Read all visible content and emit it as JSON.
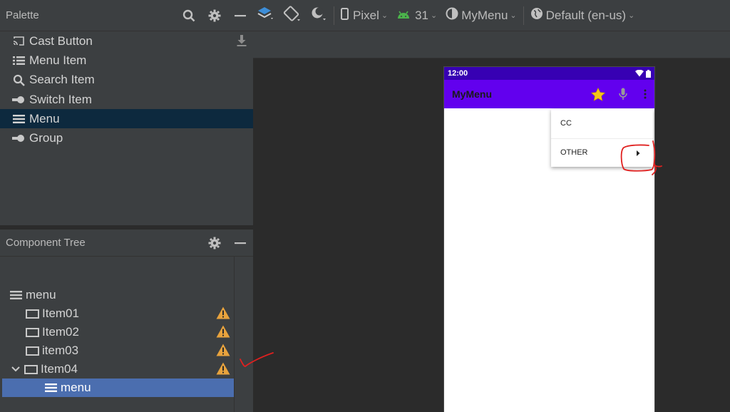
{
  "palette": {
    "title": "Palette",
    "items": [
      {
        "label": "Cast Button",
        "icon": "cast-icon"
      },
      {
        "label": "Menu Item",
        "icon": "list-icon"
      },
      {
        "label": "Search Item",
        "icon": "search-icon"
      },
      {
        "label": "Switch Item",
        "icon": "switch-icon"
      },
      {
        "label": "Menu",
        "icon": "menu-icon"
      },
      {
        "label": "Group",
        "icon": "switch-icon"
      }
    ],
    "selected_index": 4
  },
  "component_tree": {
    "title": "Component Tree",
    "rows": [
      {
        "label": "menu",
        "icon": "menu-icon",
        "warning": false
      },
      {
        "label": "Item01",
        "icon": "item-icon",
        "warning": true
      },
      {
        "label": "Item02",
        "icon": "item-icon",
        "warning": true
      },
      {
        "label": "item03",
        "icon": "item-icon",
        "warning": true
      },
      {
        "label": "Item04",
        "icon": "item-icon",
        "warning": true,
        "expanded": true
      },
      {
        "label": "menu",
        "icon": "menu-icon",
        "warning": false,
        "selected": true
      }
    ]
  },
  "toolbar": {
    "device": "Pixel",
    "api_level": "31",
    "theme": "MyMenu",
    "locale": "Default (en-us)"
  },
  "preview": {
    "status_time": "12:00",
    "app_title": "MyMenu",
    "menu_items": [
      "CC",
      "OTHER"
    ]
  },
  "colors": {
    "status_bar": "#3700b3",
    "app_bar": "#6200ee",
    "selection": "#4b6eaf",
    "warning": "#e8a33d",
    "annotation": "#e0201f"
  }
}
